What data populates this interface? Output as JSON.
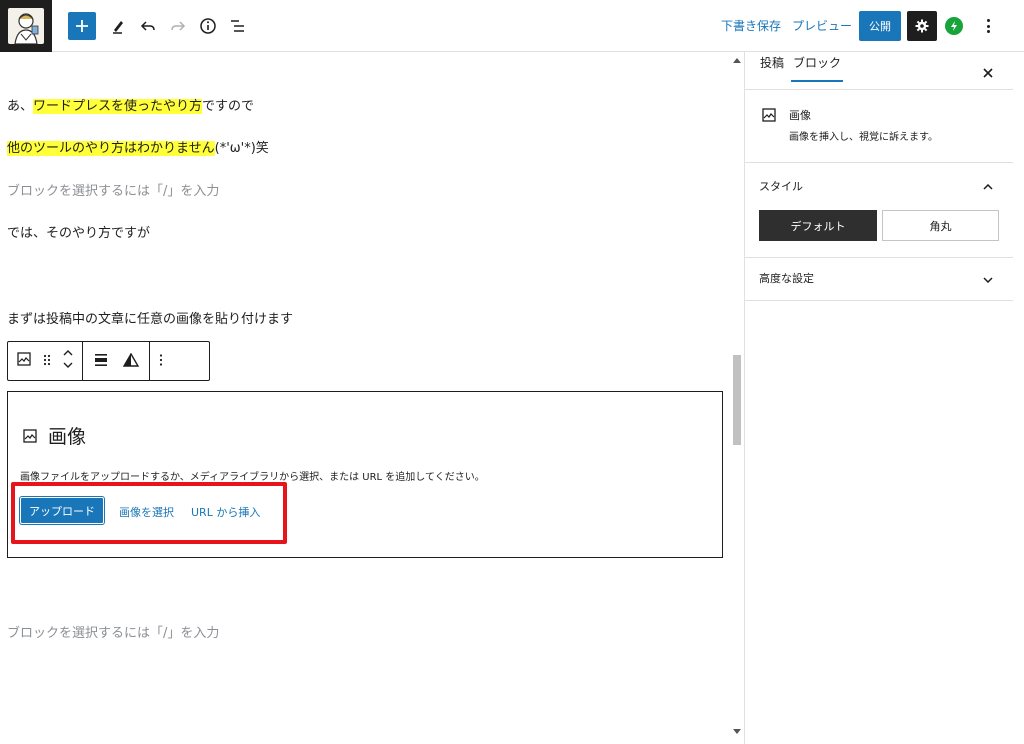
{
  "toolbar": {
    "draft_save": "下書き保存",
    "preview": "プレビュー",
    "publish": "公開"
  },
  "content": {
    "p1_prefix": "あ、",
    "p1_highlight": "ワードプレスを使ったやり方",
    "p1_suffix": "ですので",
    "p2_highlight": "他のツールのやり方はわかりません",
    "p2_suffix": "(*'ω'*)笑",
    "placeholder_1": "ブロックを選択するには「/」を入力",
    "p3": "では、そのやり方ですが",
    "p4": "まずは投稿中の文章に任意の画像を貼り付けます",
    "placeholder_2": "ブロックを選択するには「/」を入力"
  },
  "image_block": {
    "title": "画像",
    "description": "画像ファイルをアップロードするか、メディアライブラリから選択、または URL を追加してください。",
    "upload": "アップロード",
    "select_image": "画像を選択",
    "insert_url": "URL から挿入"
  },
  "sidebar": {
    "tab_post": "投稿",
    "tab_block": "ブロック",
    "block_name": "画像",
    "block_desc": "画像を挿入し、視覚に訴えます。",
    "styles_heading": "スタイル",
    "style_default": "デフォルト",
    "style_rounded": "角丸",
    "advanced_heading": "高度な設定"
  },
  "colors": {
    "accent": "#1976b8",
    "highlight": "#ffff3a",
    "annotation_red": "#e8141b"
  }
}
